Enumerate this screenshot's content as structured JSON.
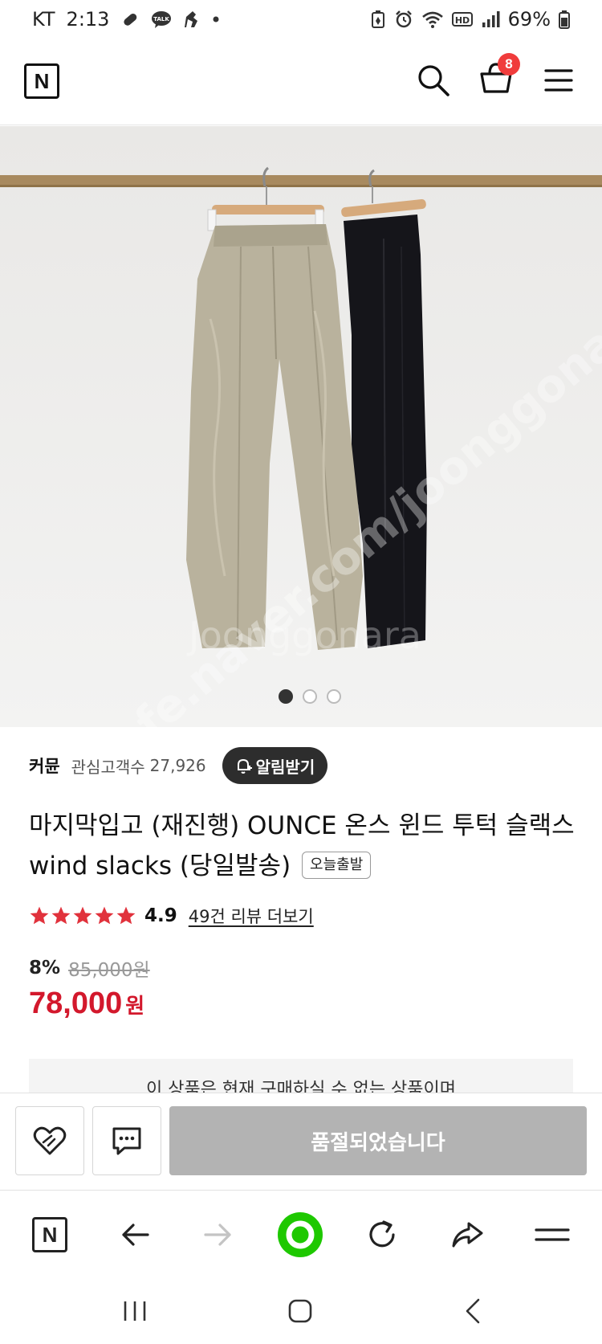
{
  "status_bar": {
    "carrier": "KT",
    "time": "2:13",
    "battery": "69%",
    "left_icons": [
      "pill-icon",
      "talk-icon",
      "figure-icon",
      "dot-icon"
    ],
    "right_icons": [
      "battery-saver-icon",
      "alarm-icon",
      "wifi-icon",
      "hd-icon",
      "signal-icon",
      "battery-icon"
    ]
  },
  "header": {
    "logo": "N",
    "cart_count": "8",
    "icons": [
      "search-icon",
      "cart-icon",
      "menu-icon"
    ]
  },
  "product_image": {
    "watermark": "cafe.naver.com/joonggonara",
    "slide_count": 3,
    "active_slide": 1
  },
  "seller": {
    "name": "커뮨",
    "fav_label": "관심고객수",
    "fav_count": "27,926",
    "alert_label": "알림받기"
  },
  "product": {
    "title": "마지막입고 (재진행) OUNCE 온스 윈드 투턱 슬랙스 wind slacks (당일발송)",
    "badge": "오늘출발"
  },
  "rating": {
    "stars": 5,
    "value": "4.9",
    "review_link": "49건 리뷰 더보기"
  },
  "price": {
    "discount_rate": "8%",
    "original": "85,000원",
    "sale": "78,000",
    "unit": "원"
  },
  "notice": {
    "text": "이 상품은 현재 구매하실 수 없는 상품이며"
  },
  "purchase_bar": {
    "soldout_label": "품절되었습니다"
  },
  "browser_bar": {
    "logo": "N",
    "items": [
      "naver-home-icon",
      "back-arrow-icon",
      "forward-arrow-icon",
      "green-dot-icon",
      "reload-icon",
      "share-icon",
      "menu-icon"
    ]
  },
  "colors": {
    "price_red": "#d3182c",
    "badge_red": "#f03c3c",
    "green_dot": "#1ec800",
    "soldout_gray": "#b3b3b3"
  }
}
